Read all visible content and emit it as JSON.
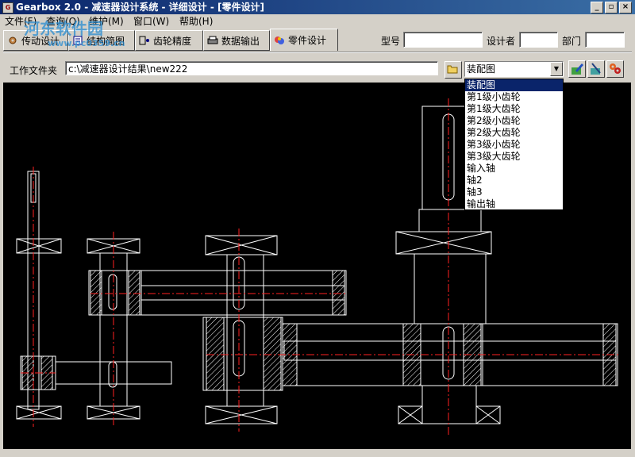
{
  "window": {
    "title": "Gearbox 2.0 - 减速器设计系统 - 详细设计 - [零件设计]",
    "icon_text": "G"
  },
  "window_controls": {
    "minimize": "_",
    "restore": "▫",
    "close": "×"
  },
  "menu": [
    {
      "label": "文件(F)"
    },
    {
      "label": "查询(Q)"
    },
    {
      "label": "维护(M)"
    },
    {
      "label": "窗口(W)"
    },
    {
      "label": "帮助(H)"
    }
  ],
  "tabs": [
    {
      "label": "传动设计",
      "icon": "gear-icon"
    },
    {
      "label": "结构简图",
      "icon": "diagram-icon"
    },
    {
      "label": "齿轮精度",
      "icon": "precision-icon"
    },
    {
      "label": "数据输出",
      "icon": "printer-icon"
    },
    {
      "label": "零件设计",
      "icon": "parts-icon",
      "active": true
    }
  ],
  "header_fields": {
    "model_label": "型号",
    "model_value": "",
    "designer_label": "设计者",
    "designer_value": "",
    "dept_label": "部门",
    "dept_value": ""
  },
  "workdir": {
    "label": "工作文件夹",
    "value": "c:\\减速器设计结果\\new222"
  },
  "part_select": {
    "selected": "装配图",
    "options": [
      "装配图",
      "第1级小齿轮",
      "第1级大齿轮",
      "第2级小齿轮",
      "第2级大齿轮",
      "第3级小齿轮",
      "第3级大齿轮",
      "输入轴",
      "轴2",
      "轴3",
      "输出轴"
    ]
  },
  "toolbar": [
    {
      "icon": "edit-icon"
    },
    {
      "icon": "tools-icon"
    },
    {
      "icon": "settings-icon"
    }
  ],
  "watermark": {
    "text": "河东软件园",
    "url": "www.pc0359.cn"
  },
  "colors": {
    "title_start": "#0a246a",
    "title_end": "#3a6ea5",
    "canvas": "#000000",
    "drawing_line": "#ffffff",
    "center_line": "#ff0000",
    "selection": "#0a246a"
  }
}
